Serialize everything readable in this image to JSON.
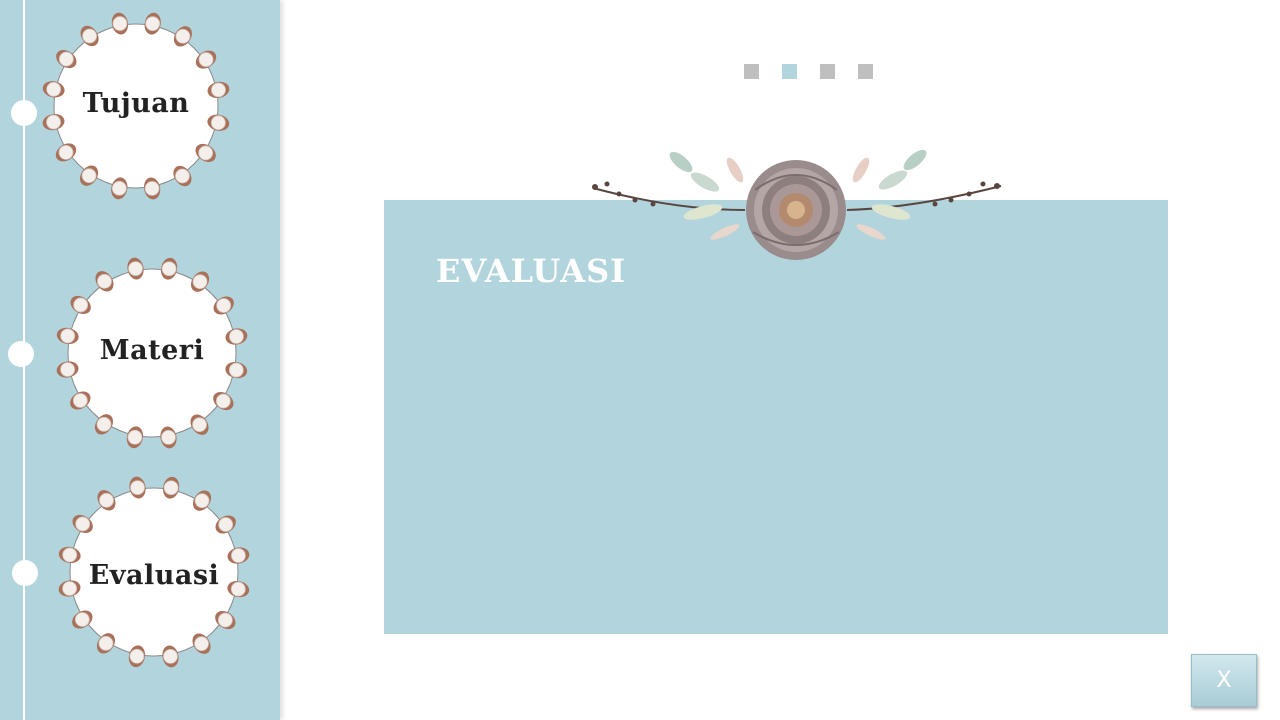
{
  "sidebar": {
    "items": [
      {
        "label": "Tujuan"
      },
      {
        "label": "Materi"
      },
      {
        "label": "Evaluasi"
      }
    ]
  },
  "slide_indicator": {
    "count": 4,
    "active_index": 1
  },
  "content": {
    "title": "EVALUASI"
  },
  "close_button": {
    "label": "X"
  },
  "colors": {
    "accent": "#b2d4dd",
    "inactive_dot": "#bfbfbf",
    "label_text": "#222222",
    "title_text": "#ffffff"
  },
  "icons": {
    "wreath": "cotton-wreath-icon",
    "floral": "floral-ornament-icon"
  }
}
